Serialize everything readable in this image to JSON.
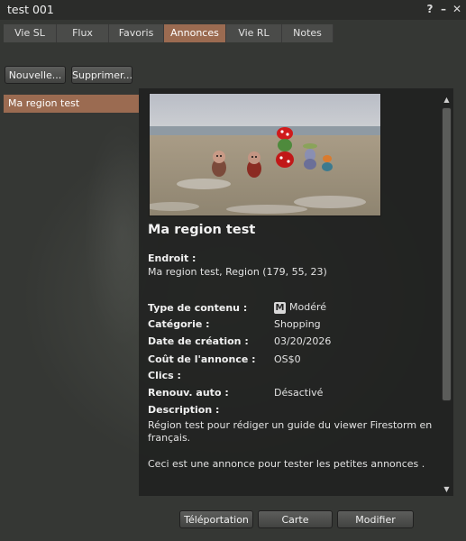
{
  "window": {
    "title": "test 001",
    "help_glyph": "?",
    "minimize_glyph": "–",
    "close_glyph": "✕"
  },
  "tabs": [
    {
      "label": "Vie SL",
      "active": false
    },
    {
      "label": "Flux",
      "active": false
    },
    {
      "label": "Favoris",
      "active": false
    },
    {
      "label": "Annonces",
      "active": true
    },
    {
      "label": "Vie RL",
      "active": false
    },
    {
      "label": "Notes",
      "active": false
    }
  ],
  "toolbar": {
    "new_label": "Nouvelle...",
    "delete_label": "Supprimer..."
  },
  "classifieds_list": [
    {
      "label": "Ma region test",
      "selected": true
    }
  ],
  "detail": {
    "title": "Ma region test",
    "location_label": "Endroit :",
    "location_value": "Ma region test, Region  (179, 55, 23)",
    "content_type_label": "Type de contenu :",
    "content_type_badge": "M",
    "content_type_value": "Modéré",
    "category_label": "Catégorie :",
    "category_value": "Shopping",
    "creation_date_label": "Date de création :",
    "creation_date_value": "03/20/2026",
    "cost_label": "Coût de l'annonce :",
    "cost_value": "OS$0",
    "clicks_label": "Clics :",
    "auto_renew_label": "Renouv. auto :",
    "auto_renew_value": "Désactivé",
    "description_label": "Description :",
    "description_line1": "Région test pour rédiger un guide du viewer Firestorm en",
    "description_line2": "français.",
    "description_line3": "Ceci est une annonce pour tester les petites annonces ."
  },
  "footer": {
    "teleport_label": "Téléportation",
    "map_label": "Carte",
    "edit_label": "Modifier"
  },
  "colors": {
    "accent": "#9b6b51",
    "panel": "#202120",
    "titlebar": "#2b2c2a"
  }
}
